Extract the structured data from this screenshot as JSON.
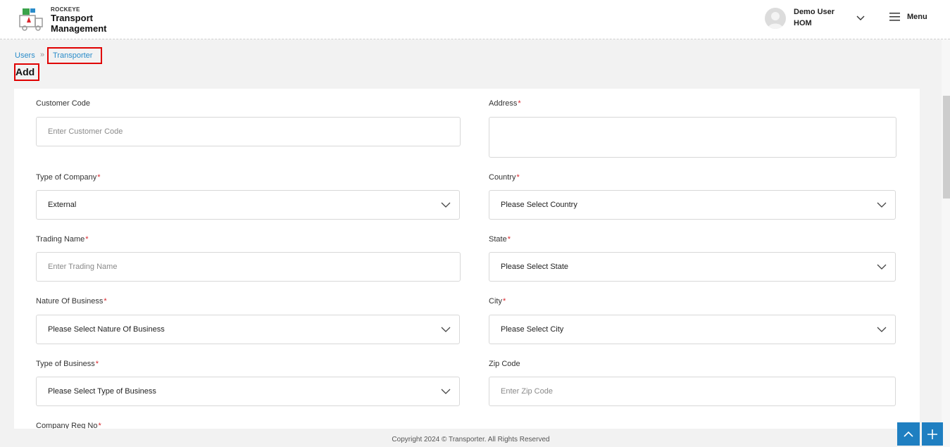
{
  "brand": {
    "small": "ROCKEYE",
    "line1": "Transport",
    "line2": "Management"
  },
  "user": {
    "name": "Demo User",
    "role": "HOM"
  },
  "menu": {
    "label": "Menu"
  },
  "breadcrumb": {
    "parent": "Users",
    "separator": "»",
    "current": "Transporter"
  },
  "page": {
    "title": "Add"
  },
  "form": {
    "customer_code": {
      "label": "Customer Code",
      "placeholder": "Enter Customer Code"
    },
    "address": {
      "label": "Address",
      "required": "*"
    },
    "type_of_company": {
      "label": "Type of Company",
      "required": "*",
      "value": "External"
    },
    "country": {
      "label": "Country",
      "required": "*",
      "value": "Please Select Country"
    },
    "trading_name": {
      "label": "Trading Name",
      "required": "*",
      "placeholder": "Enter Trading Name"
    },
    "state": {
      "label": "State",
      "required": "*",
      "value": "Please Select State"
    },
    "nature_of_business": {
      "label": "Nature Of Business",
      "required": "*",
      "value": "Please Select Nature Of Business"
    },
    "city": {
      "label": "City",
      "required": "*",
      "value": "Please Select City"
    },
    "type_of_business": {
      "label": "Type of Business",
      "required": "*",
      "value": "Please Select Type of Business"
    },
    "zip_code": {
      "label": "Zip Code",
      "placeholder": "Enter Zip Code"
    },
    "company_reg_no": {
      "label": "Company Reg No",
      "required": "*"
    }
  },
  "footer": {
    "copyright": "Copyright 2024 © Transporter. All Rights Reserved"
  },
  "colors": {
    "accent": "#1f7fc1",
    "link": "#2a8cc9",
    "required": "#d9262c",
    "highlight": "#e00000"
  },
  "icons": {
    "logo": "truck-logo-icon",
    "avatar": "user-avatar-icon",
    "user_menu": "chevron-down-icon",
    "menu": "hamburger-icon",
    "select": "chevron-down-icon",
    "scroll_top": "arrow-up-icon",
    "add": "plus-icon"
  }
}
